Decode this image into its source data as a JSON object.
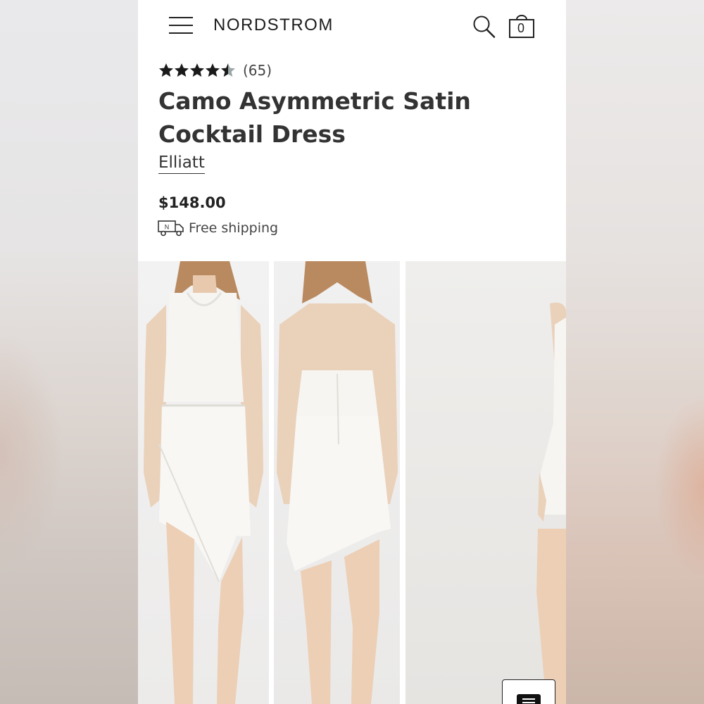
{
  "header": {
    "menu_icon": "hamburger-menu-icon",
    "logo": "NORDSTROM",
    "search_icon": "search-icon",
    "bag_icon": "shopping-bag-icon",
    "bag_count": "0"
  },
  "product": {
    "rating": {
      "value": 4.5,
      "max": 5,
      "review_count": "(65)"
    },
    "title": "Camo Asymmetric Satin Cocktail Dress",
    "brand": "Elliatt",
    "price": "$148.00",
    "shipping": {
      "icon": "delivery-truck-icon",
      "label": "Free shipping"
    }
  },
  "gallery": {
    "images": [
      "front-view-photo",
      "back-view-photo",
      "side-view-photo"
    ]
  },
  "chat": {
    "icon": "chat-icon"
  },
  "colors": {
    "text_dark": "#333333",
    "star_filled": "#1a1a1a",
    "star_empty": "#9aa5a6",
    "background": "#ffffff"
  }
}
